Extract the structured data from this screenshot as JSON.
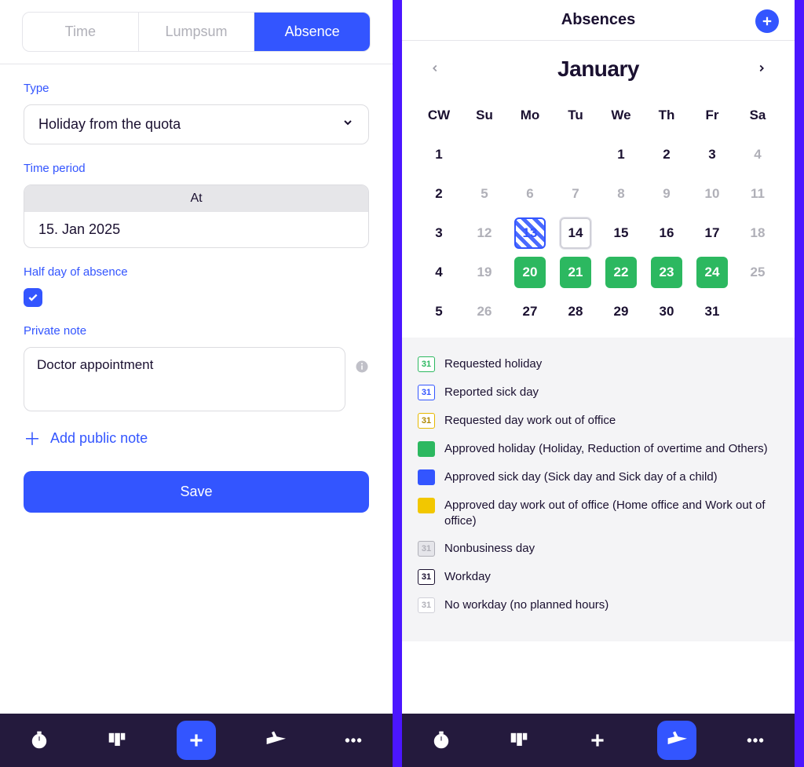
{
  "left": {
    "tabs": {
      "time": "Time",
      "lumpsum": "Lumpsum",
      "absence": "Absence"
    },
    "type_label": "Type",
    "type_value": "Holiday from the quota",
    "period_label": "Time period",
    "period_head": "At",
    "period_value": "15. Jan 2025",
    "halfday_label": "Half day of absence",
    "private_label": "Private note",
    "private_value": "Doctor appointment",
    "add_public": "Add public note",
    "save": "Save"
  },
  "right": {
    "title": "Absences",
    "month": "January",
    "dow": {
      "cw": "CW",
      "su": "Su",
      "mo": "Mo",
      "tu": "Tu",
      "we": "We",
      "th": "Th",
      "fr": "Fr",
      "sa": "Sa"
    },
    "weeks": [
      {
        "cw": "1",
        "days": [
          {
            "d": "",
            "c": ""
          },
          {
            "d": "",
            "c": ""
          },
          {
            "d": "",
            "c": ""
          },
          {
            "d": "1",
            "c": ""
          },
          {
            "d": "2",
            "c": ""
          },
          {
            "d": "3",
            "c": ""
          },
          {
            "d": "4",
            "c": "dim"
          }
        ]
      },
      {
        "cw": "2",
        "days": [
          {
            "d": "5",
            "c": "dim"
          },
          {
            "d": "6",
            "c": "dim"
          },
          {
            "d": "7",
            "c": "dim"
          },
          {
            "d": "8",
            "c": "dim"
          },
          {
            "d": "9",
            "c": "dim"
          },
          {
            "d": "10",
            "c": "dim"
          },
          {
            "d": "11",
            "c": "dim"
          }
        ]
      },
      {
        "cw": "3",
        "days": [
          {
            "d": "12",
            "c": "dim"
          },
          {
            "d": "13",
            "c": "sick"
          },
          {
            "d": "14",
            "c": "today"
          },
          {
            "d": "15",
            "c": ""
          },
          {
            "d": "16",
            "c": ""
          },
          {
            "d": "17",
            "c": ""
          },
          {
            "d": "18",
            "c": "dim"
          }
        ]
      },
      {
        "cw": "4",
        "days": [
          {
            "d": "19",
            "c": "dim"
          },
          {
            "d": "20",
            "c": "green"
          },
          {
            "d": "21",
            "c": "green"
          },
          {
            "d": "22",
            "c": "green"
          },
          {
            "d": "23",
            "c": "green"
          },
          {
            "d": "24",
            "c": "green"
          },
          {
            "d": "25",
            "c": "dim"
          }
        ]
      },
      {
        "cw": "5",
        "days": [
          {
            "d": "26",
            "c": "dim"
          },
          {
            "d": "27",
            "c": ""
          },
          {
            "d": "28",
            "c": ""
          },
          {
            "d": "29",
            "c": ""
          },
          {
            "d": "30",
            "c": ""
          },
          {
            "d": "31",
            "c": ""
          },
          {
            "d": "",
            "c": ""
          }
        ]
      }
    ],
    "legend": {
      "req_holiday": "Requested holiday",
      "rep_sick": "Reported sick day",
      "req_oof": "Requested day work out of office",
      "app_holiday": "Approved holiday (Holiday, Reduction of overtime and Others)",
      "app_sick": "Approved sick day (Sick day and Sick day of a child)",
      "app_oof": "Approved day work out of office (Home office and Work out of office)",
      "nonbiz": "Nonbusiness day",
      "workday": "Workday",
      "noworkday": "No workday (no planned hours)",
      "sample": "31"
    }
  }
}
